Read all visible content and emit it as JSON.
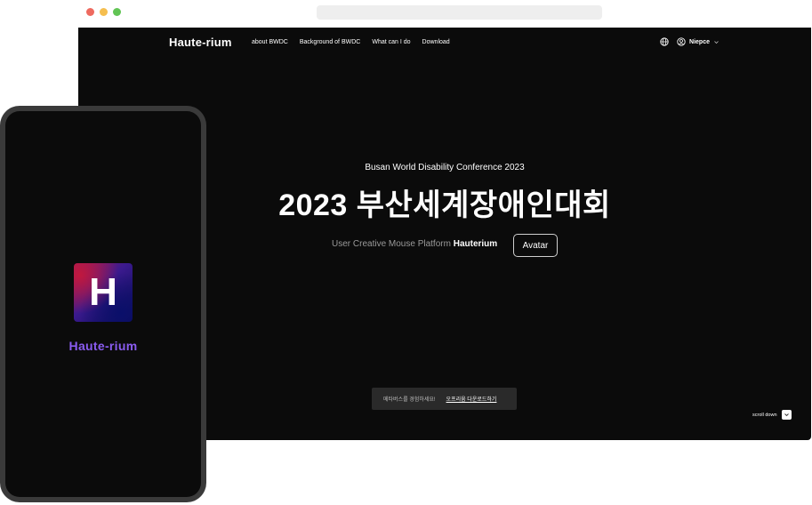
{
  "browser": {
    "dots": [
      {
        "name": "close-dot",
        "color": "#ee6a5f"
      },
      {
        "name": "minimize-dot",
        "color": "#f5be4f"
      },
      {
        "name": "maximize-dot",
        "color": "#61c454"
      }
    ]
  },
  "nav": {
    "logo": "Haute-rium",
    "links": [
      "about BWDC",
      "Background of BWDC",
      "What can I do",
      "Download"
    ],
    "globe_icon": "globe-icon",
    "user_icon": "user-icon",
    "user_name": "Niepce",
    "chevron_icon": "chevron-down-icon"
  },
  "hero": {
    "subtitle": "Busan World Disability Conference 2023",
    "title": "2023 부산세계장애인대회",
    "platform_prefix": "User Creative Mouse Platform ",
    "platform_name": "Hauterium",
    "avatar_button": "Avatar"
  },
  "download": {
    "message": "메타버스를 경험하세요!",
    "link": "오프리움 다운로드하기"
  },
  "scroll": {
    "label": "scroll down",
    "icon": "chevron-down-icon"
  },
  "phone": {
    "app_icon_letter": "H",
    "app_name": "Haute-rium"
  },
  "colors": {
    "background": "#0b0b0b",
    "accent_purple": "#8a5cf0",
    "muted_text": "#9a9a9a"
  }
}
